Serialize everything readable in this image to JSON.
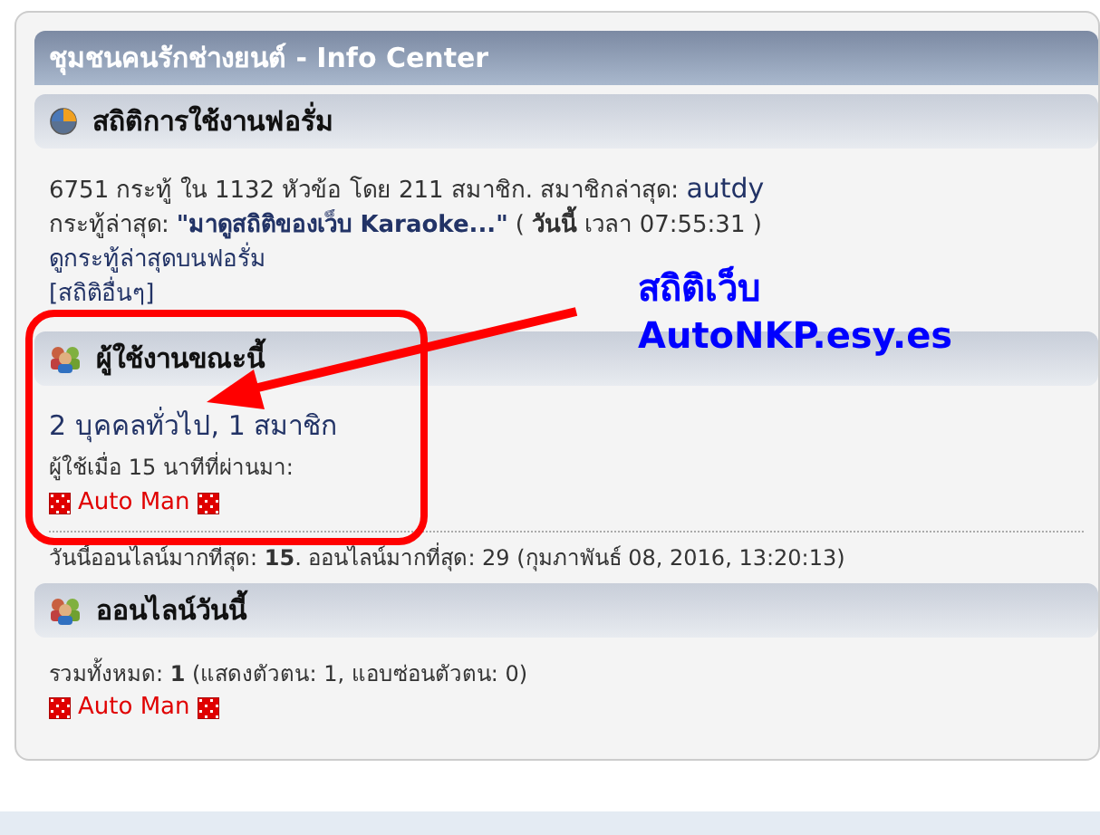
{
  "title": "ชุมชนคนรักช่างยนต์ - Info Center",
  "stats": {
    "header": "สถิติการใช้งานฟอรั่ม",
    "summary": "6751 กระทู้ ใน 1132 หัวข้อ โดย 211 สมาชิก. สมาชิกล่าสุด:",
    "newest_member": "autdy",
    "latest_label": "กระทู้ล่าสุด:",
    "latest_post": "\"มาดูสถิติของเว็บ Karaoke...\"",
    "latest_time": "( **วันนี้** เวลา 07:55:31 )",
    "recent_link": "ดูกระทู้ล่าสุดบนฟอรั่ม",
    "more_link": "[สถิติอื่นๆ]"
  },
  "online_now": {
    "header": "ผู้ใช้งานขณะนี้",
    "counts": "2 บุคคลทั่วไป, 1 สมาชิก",
    "recent_label": "ผู้ใช้เมื่อ 15 นาทีที่ผ่านมา:",
    "users": [
      "Auto Man"
    ]
  },
  "record": "วันนี้ออนไลน์มากที่สุด: **15**. ออนไลน์มากที่สุด: 29 (กุมภาพันธ์ 08, 2016, 13:20:13)",
  "online_today": {
    "header": "ออนไลน์วันนี้",
    "total": "รวมทั้งหมด: **1** (แสดงตัวตน: 1, แอบซ่อนตัวตน: 0)",
    "users": [
      "Auto Man"
    ]
  },
  "annotation": {
    "lines": [
      "สถิติเว็บ",
      "AutoNKP.esy.es"
    ]
  }
}
